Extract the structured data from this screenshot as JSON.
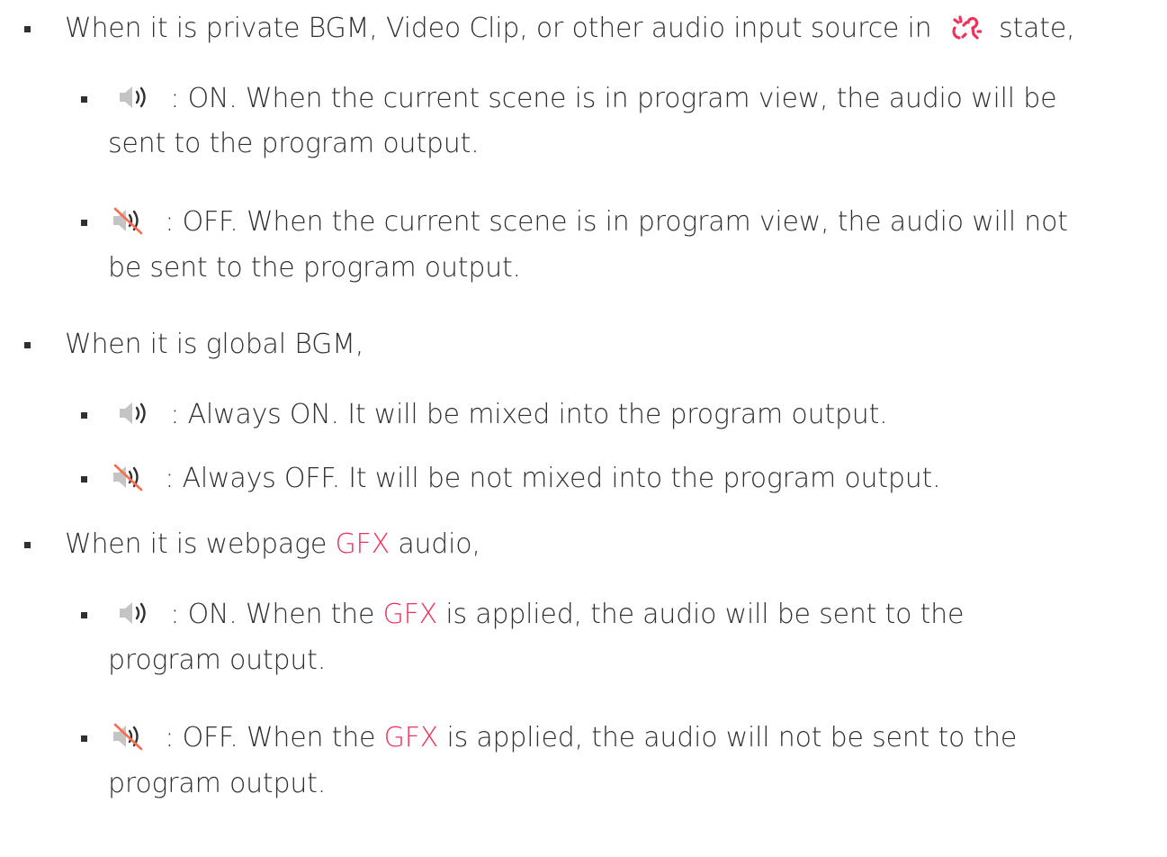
{
  "items": [
    {
      "level": 1,
      "prefix": "When it is private BGM, Video Clip, or other audio input source in",
      "icon": "broken-link-icon",
      "suffix": "state,"
    },
    {
      "level": 2,
      "icon": "speaker-on-icon",
      "text": ": ON. When the current scene is in program view, the audio will be",
      "continuation": "sent to the program output."
    },
    {
      "level": 2,
      "icon": "speaker-muted-icon",
      "text": ": OFF. When the current scene is in program view, the audio will not",
      "continuation": "be sent to the program output."
    },
    {
      "level": 1,
      "text": "When it is global BGM,"
    },
    {
      "level": 2,
      "icon": "speaker-on-icon",
      "text": ": Always ON. It will be mixed into the program output."
    },
    {
      "level": 2,
      "icon": "speaker-muted-icon",
      "text": ": Always OFF. It will be not mixed into the program output."
    },
    {
      "level": 1,
      "text_parts": [
        "When it is webpage",
        "GFX",
        "audio,"
      ]
    },
    {
      "level": 2,
      "icon": "speaker-on-icon",
      "text_parts": [
        ": ON. When the",
        "GFX",
        "is applied, the audio will be sent to the"
      ],
      "continuation": "program output."
    },
    {
      "level": 2,
      "icon": "speaker-muted-icon",
      "text_parts": [
        ": OFF. When the",
        "GFX",
        "is applied, the audio will not be sent to the"
      ],
      "continuation": "program output."
    }
  ],
  "colors": {
    "text": "#2e3036",
    "highlight": "#f0325a",
    "icon_gray": "#c4c4c4",
    "mute_slash": "#ff6a4d"
  }
}
